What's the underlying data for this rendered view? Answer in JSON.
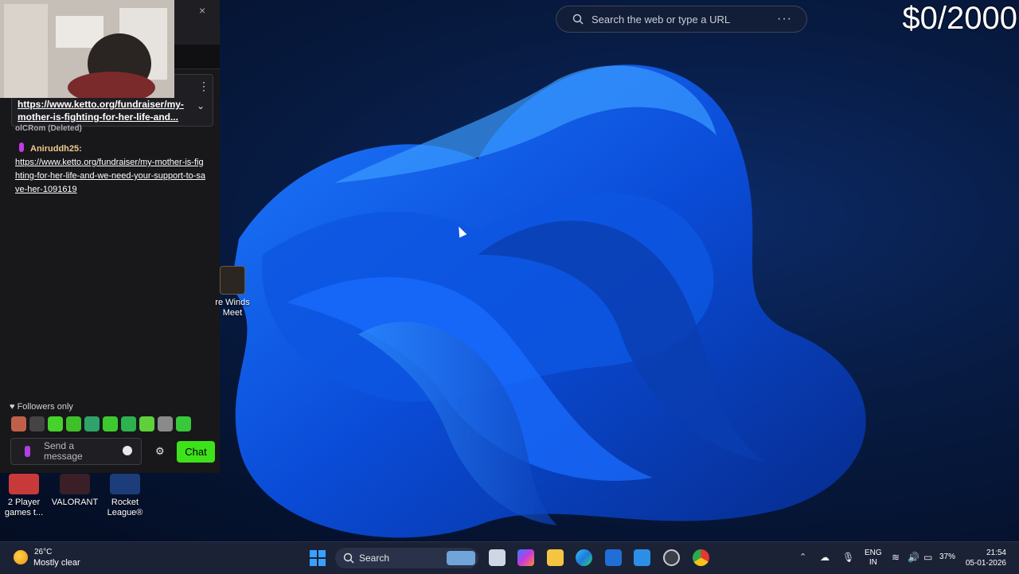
{
  "browser": {
    "search_placeholder": "Search the web or type a URL",
    "more_label": "···"
  },
  "stream_overlay": {
    "goal_text": "$0/2000"
  },
  "chat": {
    "close_label": "×",
    "pinned": {
      "link_text": "https://www.ketto.org/fundraiser/my-mother-is-fighting-for-her-life-and...",
      "menu_label": "⋮",
      "expand_label": "⌄"
    },
    "deleted_message": "olCRom (Deleted)",
    "messages": [
      {
        "user": "Aniruddh25:",
        "text": "https://www.ketto.org/fundraiser/my-mother-is-fighting-for-her-life-and-we-need-your-support-to-save-her-1091619"
      }
    ],
    "followers_only": "♥ Followers only",
    "input_placeholder": "Send a message",
    "chat_button": "Chat",
    "settings_icon": "gear-icon"
  },
  "desktop_icons": [
    {
      "label": "re Winds Meet",
      "icon": "game-icon"
    },
    {
      "label": "2 Player games t...",
      "icon": "game-icon"
    },
    {
      "label": "VALORANT",
      "icon": "valorant-icon"
    },
    {
      "label": "Rocket League®",
      "icon": "rocket-league-icon"
    }
  ],
  "taskbar": {
    "weather_temp": "26°C",
    "weather_condition": "Mostly clear",
    "search_label": "Search",
    "language_line1": "ENG",
    "language_line2": "IN",
    "battery": "37%",
    "time": "21:54",
    "date": "05-01-2026"
  },
  "colors": {
    "chat_button": "#3de21a",
    "username": "#f2c88c",
    "accent_blue": "#3aa0ff"
  }
}
